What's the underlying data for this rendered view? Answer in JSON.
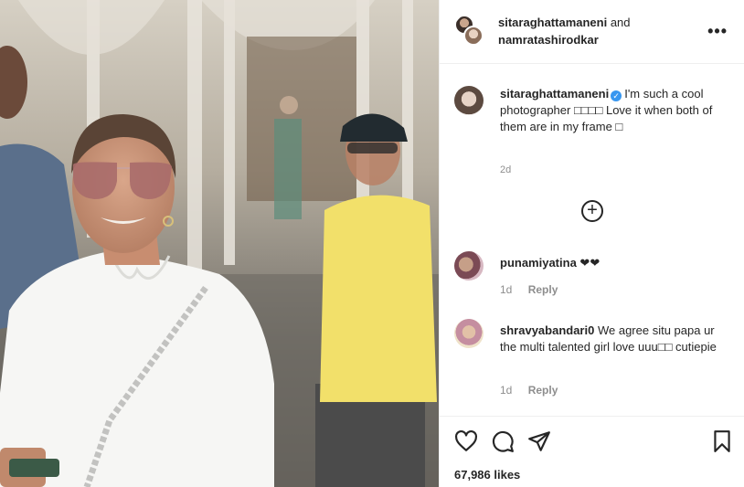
{
  "header": {
    "user1": "sitaraghattamaneni",
    "joiner": "and",
    "user2": "namratashirodkar",
    "more_label": "•••"
  },
  "caption": {
    "username": "sitaraghattamaneni",
    "verified_mark": "✓",
    "text": "I'm such a cool photographer □□□□ Love it when both of them are in my frame □",
    "time": "2d"
  },
  "load_more_label": "+",
  "comments": [
    {
      "username": "punamiyatina",
      "text": "❤❤",
      "time": "1d",
      "reply_label": "Reply"
    },
    {
      "username": "shravyabandari0",
      "text": "We agree situ papa ur the multi talented girl love uuu□□ cutiepie",
      "time": "1d",
      "reply_label": "Reply"
    }
  ],
  "actions": {
    "like_icon": "heart-icon",
    "comment_icon": "comment-icon",
    "share_icon": "share-icon",
    "save_icon": "bookmark-icon"
  },
  "likes": "67,986 likes"
}
